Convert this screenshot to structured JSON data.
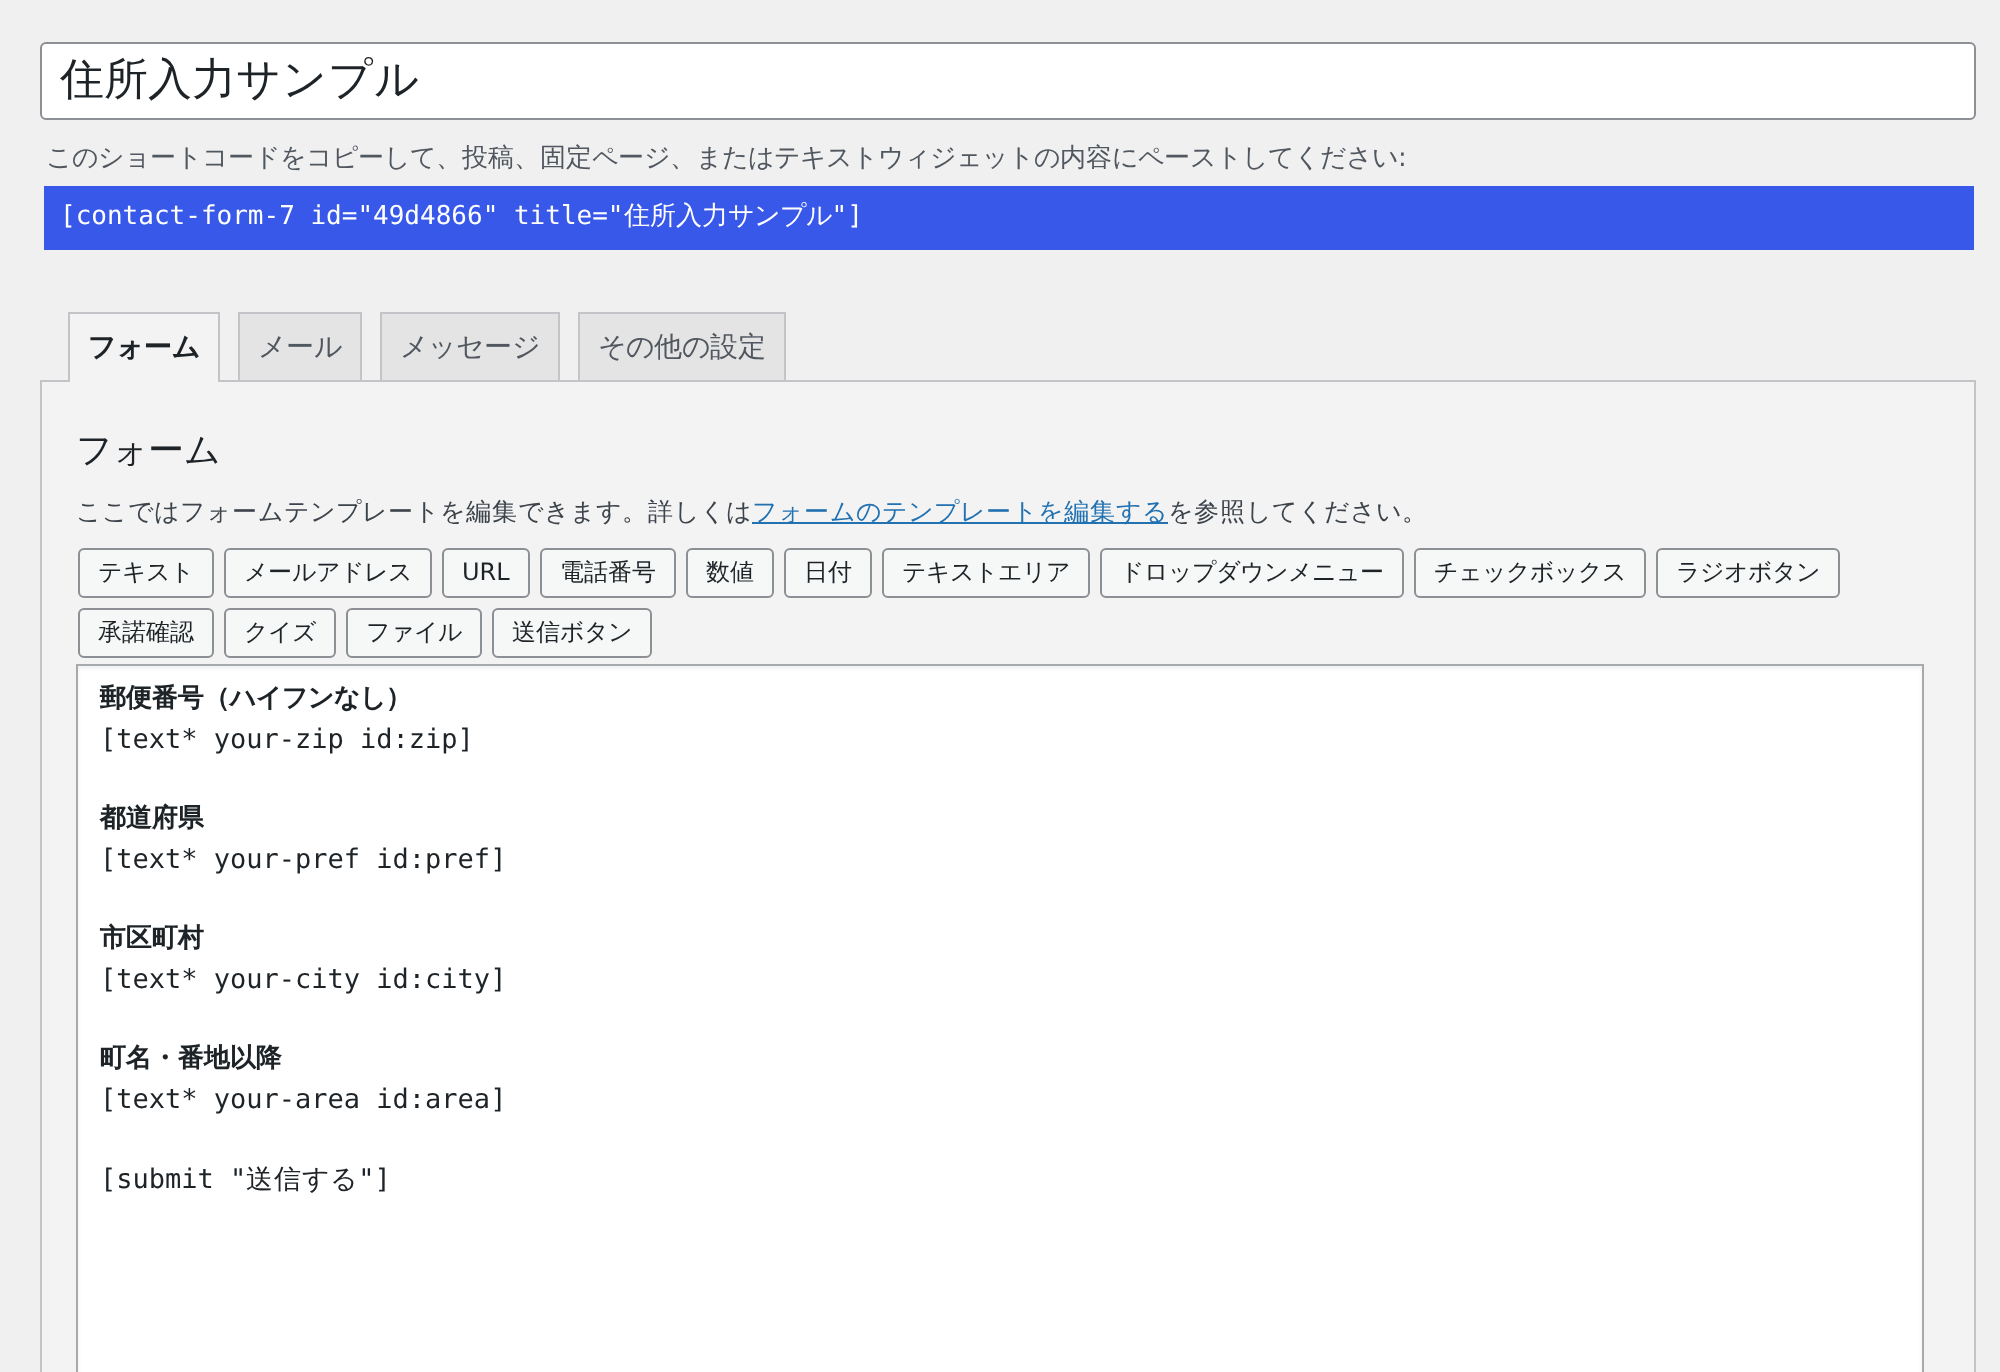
{
  "title_field": {
    "value": "住所入力サンプル"
  },
  "shortcode": {
    "hint": "このショートコードをコピーして、投稿、固定ページ、またはテキストウィジェットの内容にペーストしてください:",
    "value": "[contact-form-7 id=\"49d4866\" title=\"住所入力サンプル\"]",
    "highlighted": true
  },
  "tabs": [
    {
      "label": "フォーム",
      "selected": true
    },
    {
      "label": "メール",
      "selected": false
    },
    {
      "label": "メッセージ",
      "selected": false
    },
    {
      "label": "その他の設定",
      "selected": false
    }
  ],
  "panel": {
    "heading": "フォーム",
    "help": {
      "before": "ここではフォームテンプレートを編集できます。詳しくは",
      "link": "フォームのテンプレートを編集する",
      "after": "を参照してください。"
    },
    "tag_buttons": [
      "テキスト",
      "メールアドレス",
      "URL",
      "電話番号",
      "数値",
      "日付",
      "テキストエリア",
      "ドロップダウンメニュー",
      "チェックボックス",
      "ラジオボタン",
      "承諾確認",
      "クイズ",
      "ファイル",
      "送信ボタン"
    ],
    "template": {
      "fields": [
        {
          "label": "郵便番号（ハイフンなし）",
          "code": "[text* your-zip id:zip]"
        },
        {
          "label": "都道府県",
          "code": "[text* your-pref id:pref]"
        },
        {
          "label": "市区町村",
          "code": "[text* your-city id:city]"
        },
        {
          "label": "町名・番地以降",
          "code": "[text* your-area id:area]"
        }
      ],
      "submit": "[submit \"送信する\"]"
    }
  }
}
